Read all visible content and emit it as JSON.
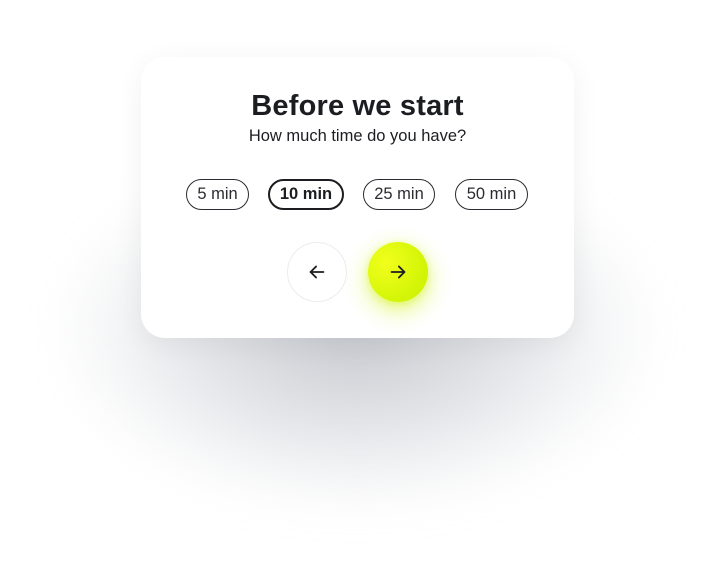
{
  "card": {
    "title": "Before we start",
    "subtitle": "How much time do you have?"
  },
  "options": [
    {
      "label": "5 min",
      "selected": false
    },
    {
      "label": "10 min",
      "selected": true
    },
    {
      "label": "25 min",
      "selected": false
    },
    {
      "label": "50 min",
      "selected": false
    }
  ],
  "navigation": {
    "back_icon": "arrow-left-icon",
    "next_icon": "arrow-right-icon",
    "next_color": "#d8f70a"
  }
}
